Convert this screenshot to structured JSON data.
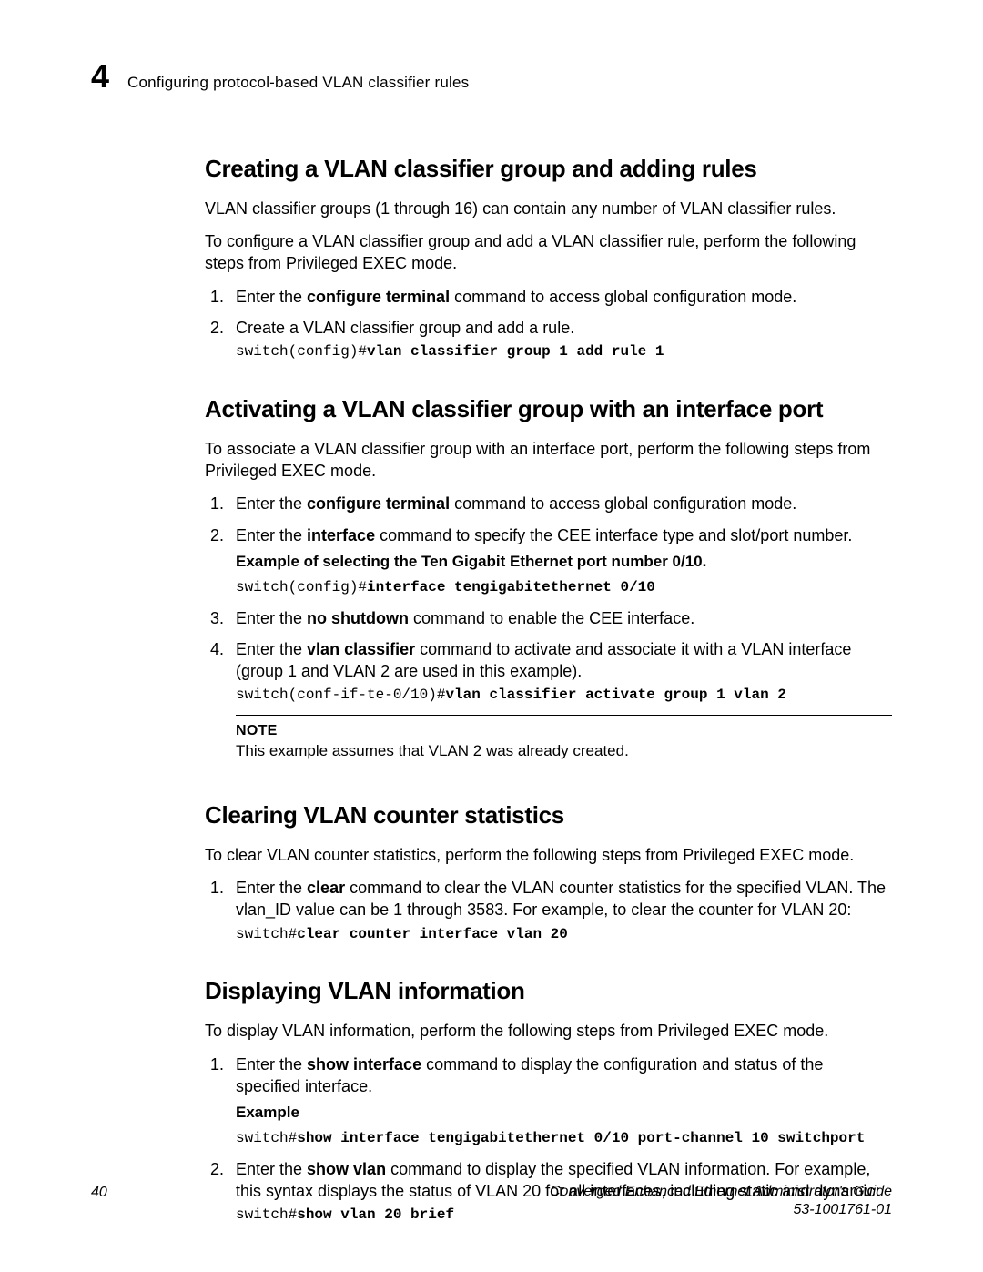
{
  "header": {
    "chapter": "4",
    "running_head": "Configuring protocol-based VLAN classifier rules"
  },
  "sections": {
    "create": {
      "heading": "Creating a VLAN classifier group and adding rules",
      "intro1": "VLAN classifier groups (1 through 16) can contain any number of VLAN classifier rules.",
      "intro2": "To configure a VLAN classifier group and add a VLAN classifier rule, perform the following steps from Privileged EXEC mode.",
      "step1_pre": "Enter the ",
      "step1_cmd": "configure terminal",
      "step1_post": " command to access global configuration mode.",
      "step2": "Create a VLAN classifier group and add a rule.",
      "code1_prompt": "switch(config)#",
      "code1_cmd": "vlan classifier group 1 add rule 1"
    },
    "activate": {
      "heading": "Activating a VLAN classifier group with an interface port",
      "intro": "To associate a VLAN classifier group with an interface port, perform the following steps from Privileged EXEC mode.",
      "step1_pre": "Enter the ",
      "step1_cmd": "configure terminal",
      "step1_post": " command to access global configuration mode.",
      "step2_pre": "Enter the ",
      "step2_cmd": "interface",
      "step2_post": " command to specify the CEE interface type and slot/port number.",
      "example_head": "Example  of selecting the Ten Gigabit Ethernet port number 0/10.",
      "code1_prompt": "switch(config)#",
      "code1_cmd": "interface tengigabitethernet 0/10",
      "step3_pre": "Enter the ",
      "step3_cmd": "no shutdown",
      "step3_post": " command to enable the CEE interface.",
      "step4_pre": "Enter the ",
      "step4_cmd": "vlan classifier",
      "step4_post": " command to activate and associate it with a VLAN interface (group 1 and VLAN 2 are used in this example).",
      "code2_prompt": "switch(conf-if-te-0/10)#",
      "code2_cmd": "vlan classifier activate group 1 vlan 2",
      "note_label": "NOTE",
      "note_text": "This example assumes that VLAN 2 was already created."
    },
    "clear": {
      "heading": "Clearing VLAN counter statistics",
      "intro": "To clear VLAN counter statistics, perform the following steps from Privileged EXEC mode.",
      "step1_pre": "Enter the ",
      "step1_cmd": "clear",
      "step1_post": " command to clear the VLAN counter statistics for the specified VLAN. The vlan_ID value can be 1 through 3583. For example, to clear the counter for VLAN 20:",
      "code1_prompt": "switch#",
      "code1_cmd": "clear counter interface vlan 20"
    },
    "display": {
      "heading": "Displaying VLAN information",
      "intro": "To display VLAN information, perform the following steps from Privileged EXEC mode.",
      "step1_pre": "Enter the ",
      "step1_cmd": "show interface",
      "step1_post": " command to display the configuration and status of the specified interface.",
      "example_label": "Example",
      "code1_prompt": "switch#",
      "code1_cmd": "show interface tengigabitethernet 0/10 port-channel 10 switchport",
      "step2_pre": "Enter the ",
      "step2_cmd": "show vlan",
      "step2_post": " command to display the specified VLAN information. For example, this syntax displays the status of VLAN 20 for all interfaces, including static and dynamic:",
      "code2_prompt": "switch#",
      "code2_cmd": "show vlan 20 brief"
    }
  },
  "footer": {
    "page": "40",
    "title": "Converged Enhanced Ethernet Administrator's Guide",
    "docnum": "53-1001761-01"
  }
}
